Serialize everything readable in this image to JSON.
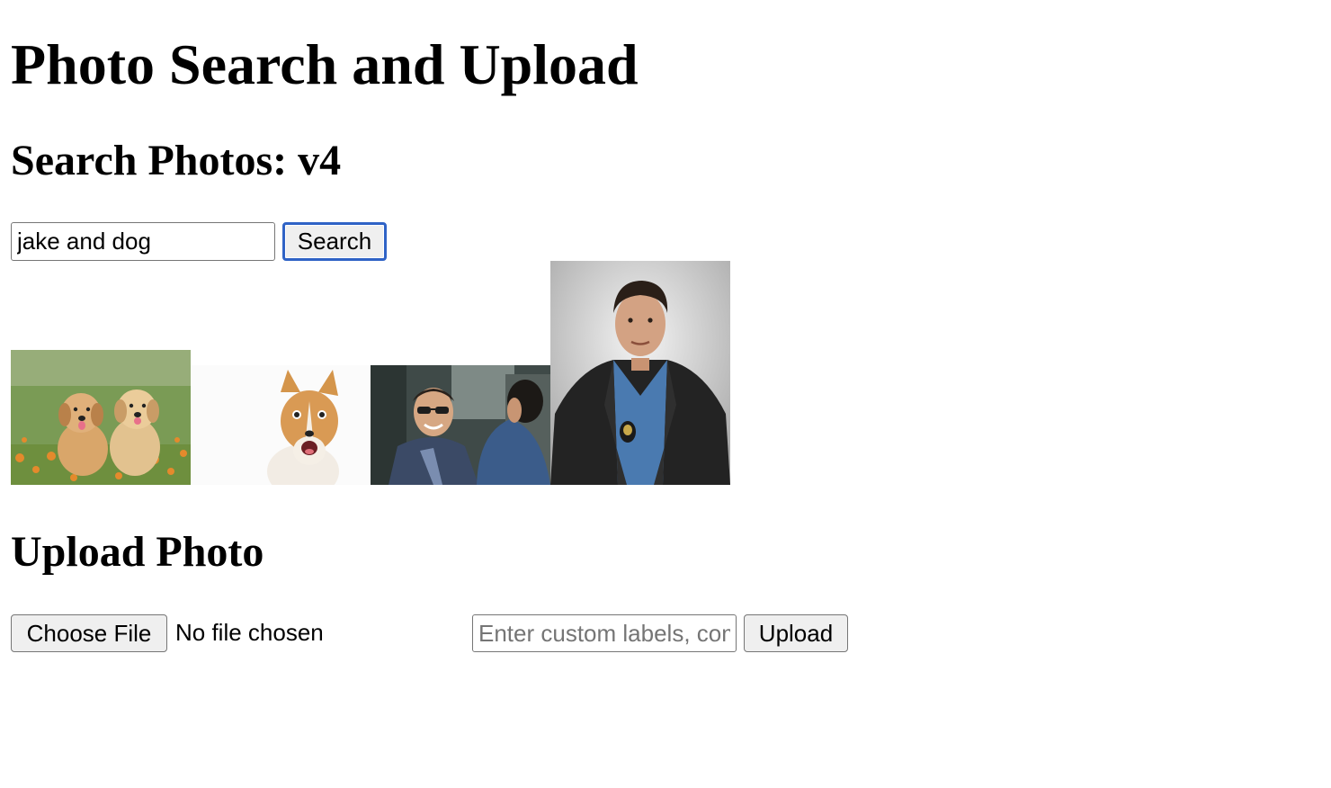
{
  "page": {
    "title": "Photo Search and Upload"
  },
  "search": {
    "heading": "Search Photos: v4",
    "query": "jake and dog",
    "button_label": "Search"
  },
  "results": [
    {
      "subject": "two golden retriever puppies in flower field",
      "icon": "puppies-photo"
    },
    {
      "subject": "corgi dog on white background",
      "icon": "corgi-photo"
    },
    {
      "subject": "smiling man in sunglasses with officer",
      "icon": "man-sunglasses-photo"
    },
    {
      "subject": "man in leather jacket with police badge",
      "icon": "detective-portrait-photo"
    }
  ],
  "upload": {
    "heading": "Upload Photo",
    "choose_file_label": "Choose File",
    "file_status": "No file chosen",
    "labels_placeholder": "Enter custom labels, comma separated",
    "button_label": "Upload"
  },
  "colors": {
    "focus_ring": "#2f63c6",
    "button_bg": "#efefef",
    "border": "#767676"
  }
}
